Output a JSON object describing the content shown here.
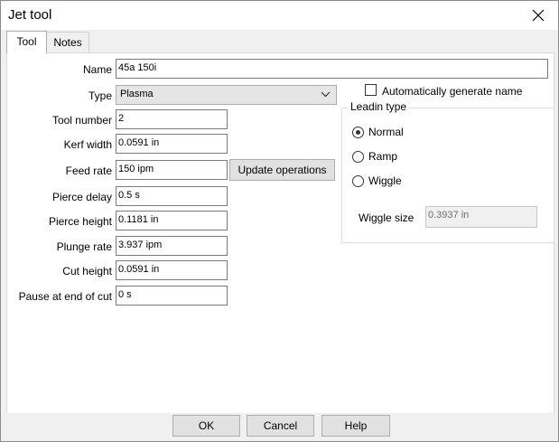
{
  "window": {
    "title": "Jet tool"
  },
  "tabs": [
    {
      "label": "Tool"
    },
    {
      "label": "Notes"
    }
  ],
  "form": {
    "name_label": "Name",
    "name_value": "45a 150i",
    "type_label": "Type",
    "type_value": "Plasma",
    "tool_number_label": "Tool number",
    "tool_number_value": "2",
    "kerf_width_label": "Kerf width",
    "kerf_width_value": "0.0591 in",
    "feed_rate_label": "Feed rate",
    "feed_rate_value": "150 ipm",
    "update_operations_label": "Update operations",
    "pierce_delay_label": "Pierce delay",
    "pierce_delay_value": "0.5 s",
    "pierce_height_label": "Pierce height",
    "pierce_height_value": "0.1181 in",
    "plunge_rate_label": "Plunge rate",
    "plunge_rate_value": "3.937 ipm",
    "cut_height_label": "Cut height",
    "cut_height_value": "0.0591 in",
    "pause_label": "Pause at end of cut",
    "pause_value": "0 s"
  },
  "auto_name": {
    "label": "Automatically generate name",
    "checked": false
  },
  "leadin": {
    "group_label": "Leadin type",
    "options": [
      {
        "label": "Normal",
        "selected": true
      },
      {
        "label": "Ramp",
        "selected": false
      },
      {
        "label": "Wiggle",
        "selected": false
      }
    ],
    "wiggle_size_label": "Wiggle size",
    "wiggle_size_value": "0.3937 in"
  },
  "footer": {
    "ok_label": "OK",
    "cancel_label": "Cancel",
    "help_label": "Help"
  }
}
